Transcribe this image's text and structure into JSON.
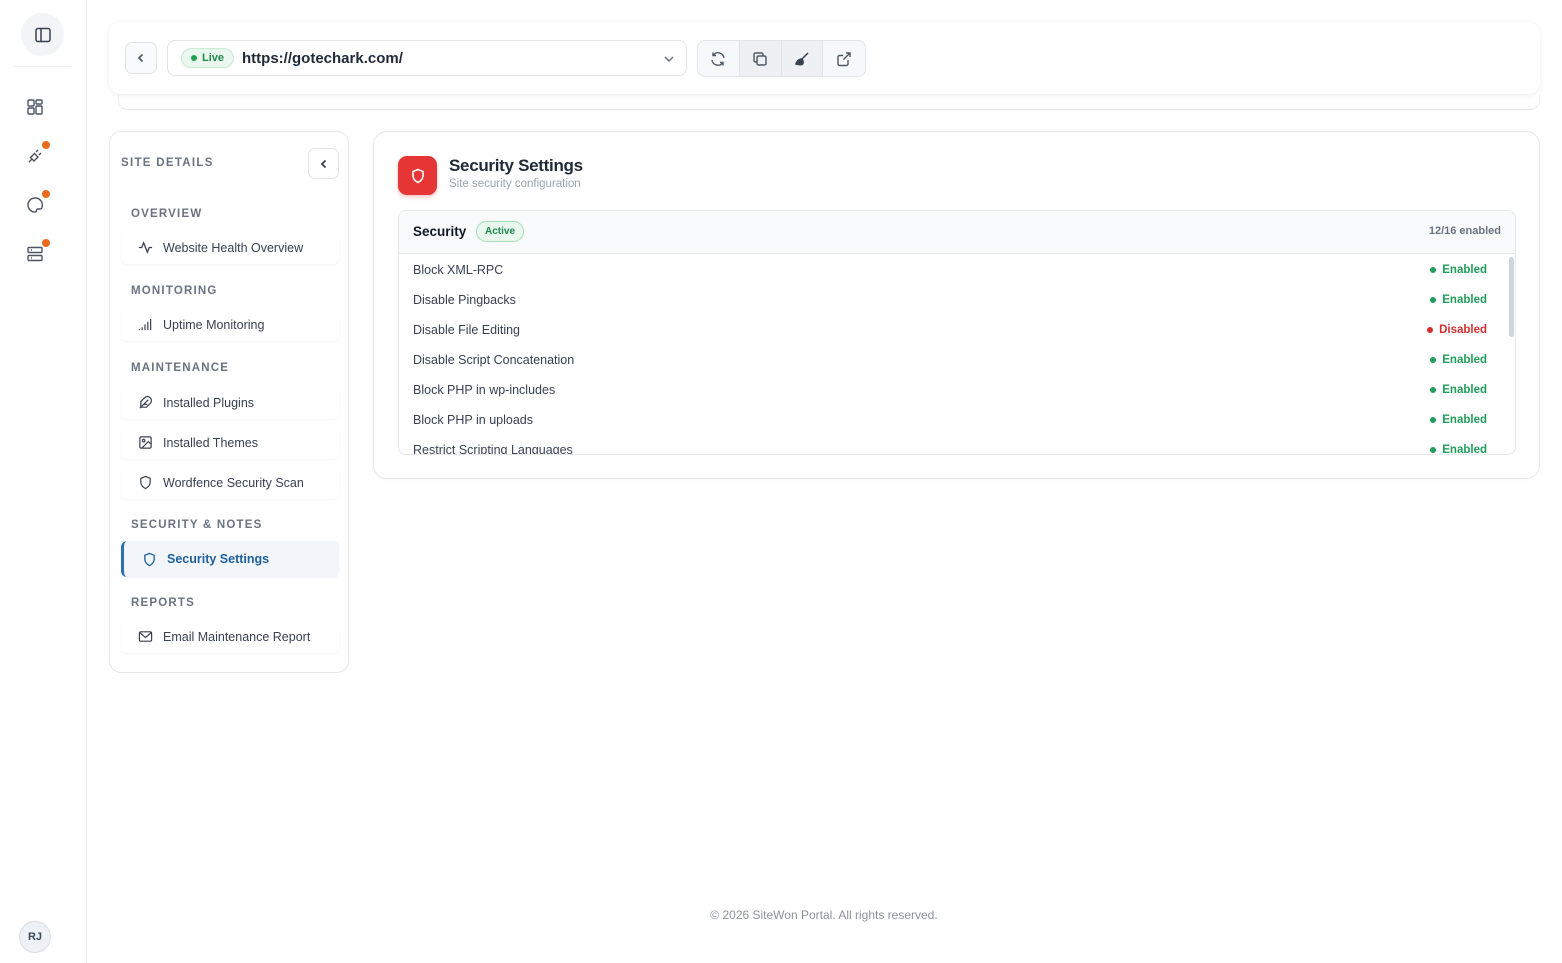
{
  "topbar": {
    "live_label": "Live",
    "url": "https://gotechark.com/"
  },
  "rail": {
    "avatar_initials": "RJ"
  },
  "sidebar": {
    "title": "SITE DETAILS",
    "sections": [
      {
        "heading": "OVERVIEW",
        "items": [
          {
            "label": "Website Health Overview",
            "icon": "activity-icon"
          }
        ]
      },
      {
        "heading": "MONITORING",
        "items": [
          {
            "label": "Uptime Monitoring",
            "icon": "signal-bars-icon"
          }
        ]
      },
      {
        "heading": "MAINTENANCE",
        "items": [
          {
            "label": "Installed Plugins",
            "icon": "feather-icon"
          },
          {
            "label": "Installed Themes",
            "icon": "image-icon"
          },
          {
            "label": "Wordfence Security Scan",
            "icon": "shield-icon"
          }
        ]
      },
      {
        "heading": "SECURITY & NOTES",
        "items": [
          {
            "label": "Security Settings",
            "icon": "shield-icon",
            "active": true
          }
        ]
      },
      {
        "heading": "REPORTS",
        "items": [
          {
            "label": "Email Maintenance Report",
            "icon": "mail-icon"
          }
        ]
      }
    ]
  },
  "main": {
    "title": "Security Settings",
    "subtitle": "Site security configuration",
    "card": {
      "title": "Security",
      "badge": "Active",
      "count": "12/16 enabled",
      "rows": [
        {
          "label": "Block XML-RPC",
          "status": "Enabled"
        },
        {
          "label": "Disable Pingbacks",
          "status": "Enabled"
        },
        {
          "label": "Disable File Editing",
          "status": "Disabled"
        },
        {
          "label": "Disable Script Concatenation",
          "status": "Enabled"
        },
        {
          "label": "Block PHP in wp-includes",
          "status": "Enabled"
        },
        {
          "label": "Block PHP in uploads",
          "status": "Enabled"
        },
        {
          "label": "Restrict Scripting Languages",
          "status": "Enabled"
        }
      ]
    }
  },
  "footer": {
    "text": "© 2026 SiteWon Portal. All rights reserved."
  },
  "colors": {
    "enabled": "#1f9d5a",
    "disabled": "#d42f2f",
    "accent": "#2f6eb0",
    "danger_icon_bg": "#e53535"
  }
}
